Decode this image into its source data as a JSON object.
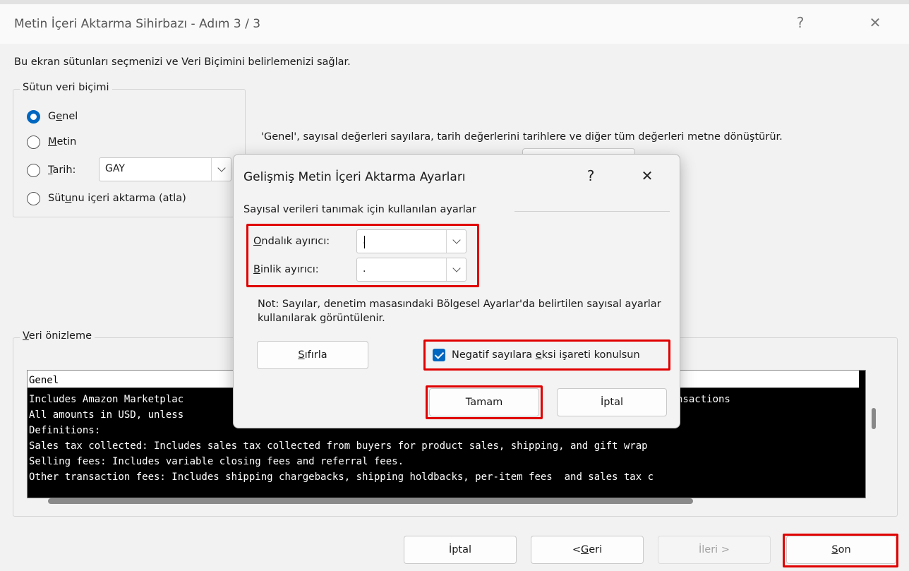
{
  "window": {
    "title": "Metin İçeri Aktarma Sihirbazı - Adım 3 / 3",
    "help_glyph": "?",
    "close_glyph": "✕"
  },
  "intro_text": "Bu ekran sütunları seçmenizi ve Veri Biçimini belirlemenizi  sağlar.",
  "column_format": {
    "legend": "Sütun veri biçimi",
    "options": [
      {
        "before": "G",
        "key": "e",
        "after": "nel",
        "selected": true
      },
      {
        "before": "",
        "key": "M",
        "after": "etin",
        "selected": false
      },
      {
        "before": "",
        "key": "T",
        "after": "arih:",
        "selected": false
      },
      {
        "before": "Süt",
        "key": "u",
        "after": "nu içeri aktarma (atla)",
        "selected": false
      }
    ],
    "date_format": "GAY"
  },
  "description": "'Genel', sayısal değerleri sayılara, tarih değerlerini tarihlere ve diğer tüm değerleri metne dönüştürür.",
  "preview": {
    "legend_key": "V",
    "legend_rest": "eri önizleme",
    "header": "Genel",
    "lines": [
      "Includes Amazon Marketplac",
      "All amounts in USD, unless",
      "Definitions:",
      "Sales tax collected: Includes sales tax collected from buyers for product sales, shipping, and gift wrap",
      "Selling fees: Includes variable closing fees and referral fees.",
      "Other transaction fees: Includes shipping chargebacks, shipping holdbacks, per-item fees  and sales tax c"
    ],
    "line1_tail": "nsactions"
  },
  "buttons": {
    "cancel": "İptal",
    "back_prefix": "< ",
    "back_key": "G",
    "back_rest": "eri",
    "next": "İleri >",
    "finish_key": "S",
    "finish_rest": "on"
  },
  "advanced_dialog": {
    "title": "Gelişmiş Metin İçeri Aktarma Ayarları",
    "help_glyph": "?",
    "close_glyph": "✕",
    "section": "Sayısal verileri tanımak için kullanılan ayarlar",
    "decimal_key": "O",
    "decimal_rest": "ndalık ayırıcı:",
    "decimal_value": ".",
    "thousands_key": "B",
    "thousands_rest": "inlik ayırıcı:",
    "thousands_value": ".",
    "note": "Not: Sayılar, denetim masasındaki Bölgesel Ayarlar'da belirtilen sayısal ayarlar kullanılarak görüntülenir.",
    "reset_key": "S",
    "reset_rest": "ıfırla",
    "negative_before": "Negatif sayılara ",
    "negative_key": "e",
    "negative_after": "ksi işareti konulsun",
    "negative_checked": true,
    "ok": "Tamam",
    "cancel": "İptal"
  },
  "colors": {
    "accent": "#0067c0",
    "highlight": "#e00000"
  }
}
